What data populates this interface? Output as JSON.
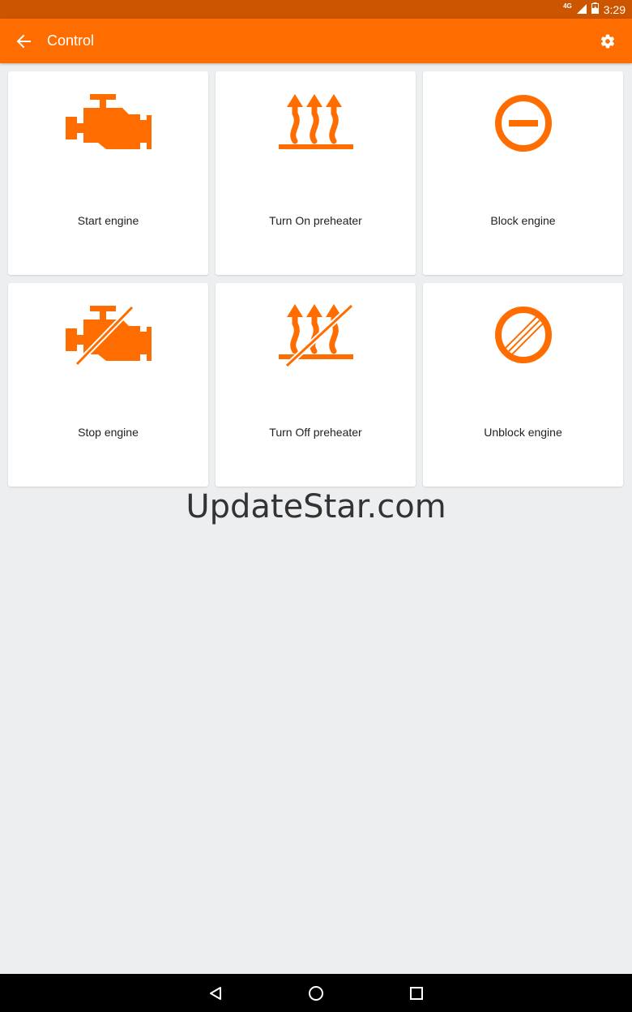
{
  "status_bar": {
    "network": "4G",
    "time": "3:29"
  },
  "app_bar": {
    "title": "Control",
    "back_icon": "arrow-back-icon",
    "settings_icon": "gear-icon"
  },
  "controls": [
    {
      "label": "Start engine",
      "icon": "engine-icon"
    },
    {
      "label": "Turn On preheater",
      "icon": "preheater-icon"
    },
    {
      "label": "Block engine",
      "icon": "block-icon"
    },
    {
      "label": "Stop engine",
      "icon": "engine-off-icon"
    },
    {
      "label": "Turn Off preheater",
      "icon": "preheater-off-icon"
    },
    {
      "label": "Unblock engine",
      "icon": "unblock-icon"
    }
  ],
  "watermark": "UpdateStar.com",
  "colors": {
    "accent": "#FF6D00",
    "status_bar": "#CC5500",
    "background": "#ECEEF0"
  }
}
